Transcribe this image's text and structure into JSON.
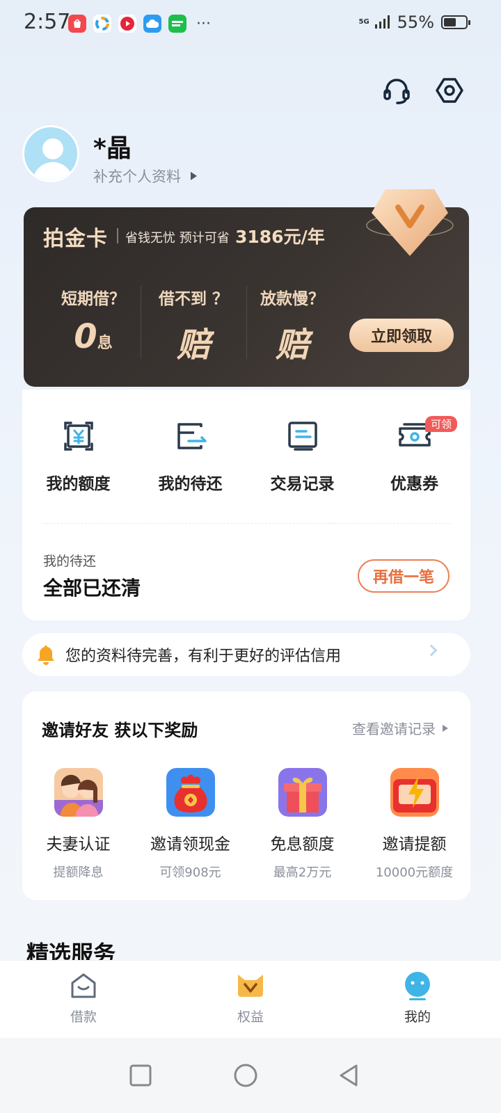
{
  "status_bar": {
    "time": "2:57",
    "network": "5G",
    "battery_percent": "55%",
    "more_dots": "···",
    "battery_level": 0.55
  },
  "profile": {
    "name": "*晶",
    "subtitle": "补充个人资料"
  },
  "vip_card": {
    "title": "拍金卡",
    "slogan": "省钱无忧 预计可省",
    "saving": "3186元/年",
    "cols": [
      {
        "question": "短期借？",
        "value": "0",
        "unit": "息"
      },
      {
        "question": "借不到 ？",
        "value": "赔",
        "unit": ""
      },
      {
        "question": "放款慢？",
        "value": "赔",
        "unit": ""
      }
    ],
    "button": "立即领取"
  },
  "quick_actions": {
    "items": [
      {
        "label": "我的额度",
        "icon": "credit-limit-icon"
      },
      {
        "label": "我的待还",
        "icon": "repayment-icon"
      },
      {
        "label": "交易记录",
        "icon": "transaction-record-icon"
      },
      {
        "label": "优惠券",
        "icon": "coupon-icon",
        "badge": "可领"
      }
    ],
    "repay_label": "我的待还",
    "repay_status": "全部已还清",
    "borrow_again": "再借一笔"
  },
  "notice": {
    "text": "您的资料待完善，有利于更好的评估信用"
  },
  "invite": {
    "title": "邀请好友 获以下奖励",
    "record_link": "查看邀请记录",
    "items": [
      {
        "label": "夫妻认证",
        "sub": "提额降息",
        "icon": "couple-icon"
      },
      {
        "label": "邀请领现金",
        "sub": "可领908元",
        "icon": "money-bag-icon"
      },
      {
        "label": "免息额度",
        "sub": "最高2万元",
        "icon": "gift-box-icon"
      },
      {
        "label": "邀请提额",
        "sub": "10000元额度",
        "icon": "lightning-box-icon"
      }
    ]
  },
  "featured_title": "精选服务",
  "tabbar": {
    "tabs": [
      {
        "label": "借款",
        "icon": "home-icon"
      },
      {
        "label": "权益",
        "icon": "benefits-icon"
      },
      {
        "label": "我的",
        "icon": "profile-icon",
        "active": true
      }
    ]
  },
  "colors": {
    "accent_orange": "#e86e3e",
    "vip_gold": "#f3dcc0",
    "active_blue": "#3fb4e6"
  }
}
